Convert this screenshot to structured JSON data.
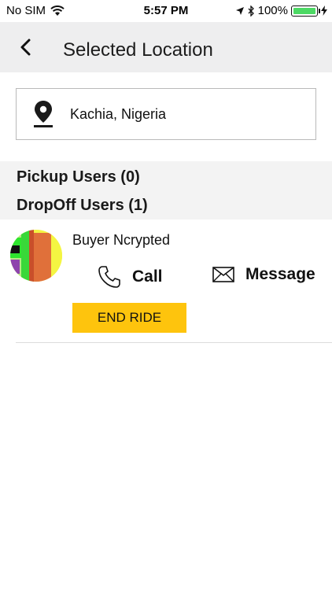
{
  "status_bar": {
    "carrier": "No SIM",
    "time": "5:57 PM",
    "battery_percent": "100%"
  },
  "header": {
    "title": "Selected Location"
  },
  "location": {
    "text": "Kachia, Nigeria"
  },
  "sections": {
    "pickup": "Pickup Users (0)",
    "dropoff": "DropOff Users (1)"
  },
  "user": {
    "name": "Buyer Ncrypted",
    "call_label": "Call",
    "message_label": "Message",
    "end_ride_label": "END RIDE"
  },
  "colors": {
    "accent": "#fec40d",
    "battery": "#4cd964",
    "navbar_bg": "#eeeeef"
  },
  "icons": {
    "back": "chevron-left-icon",
    "location": "map-pin-icon",
    "call": "phone-icon",
    "message": "envelope-icon"
  }
}
